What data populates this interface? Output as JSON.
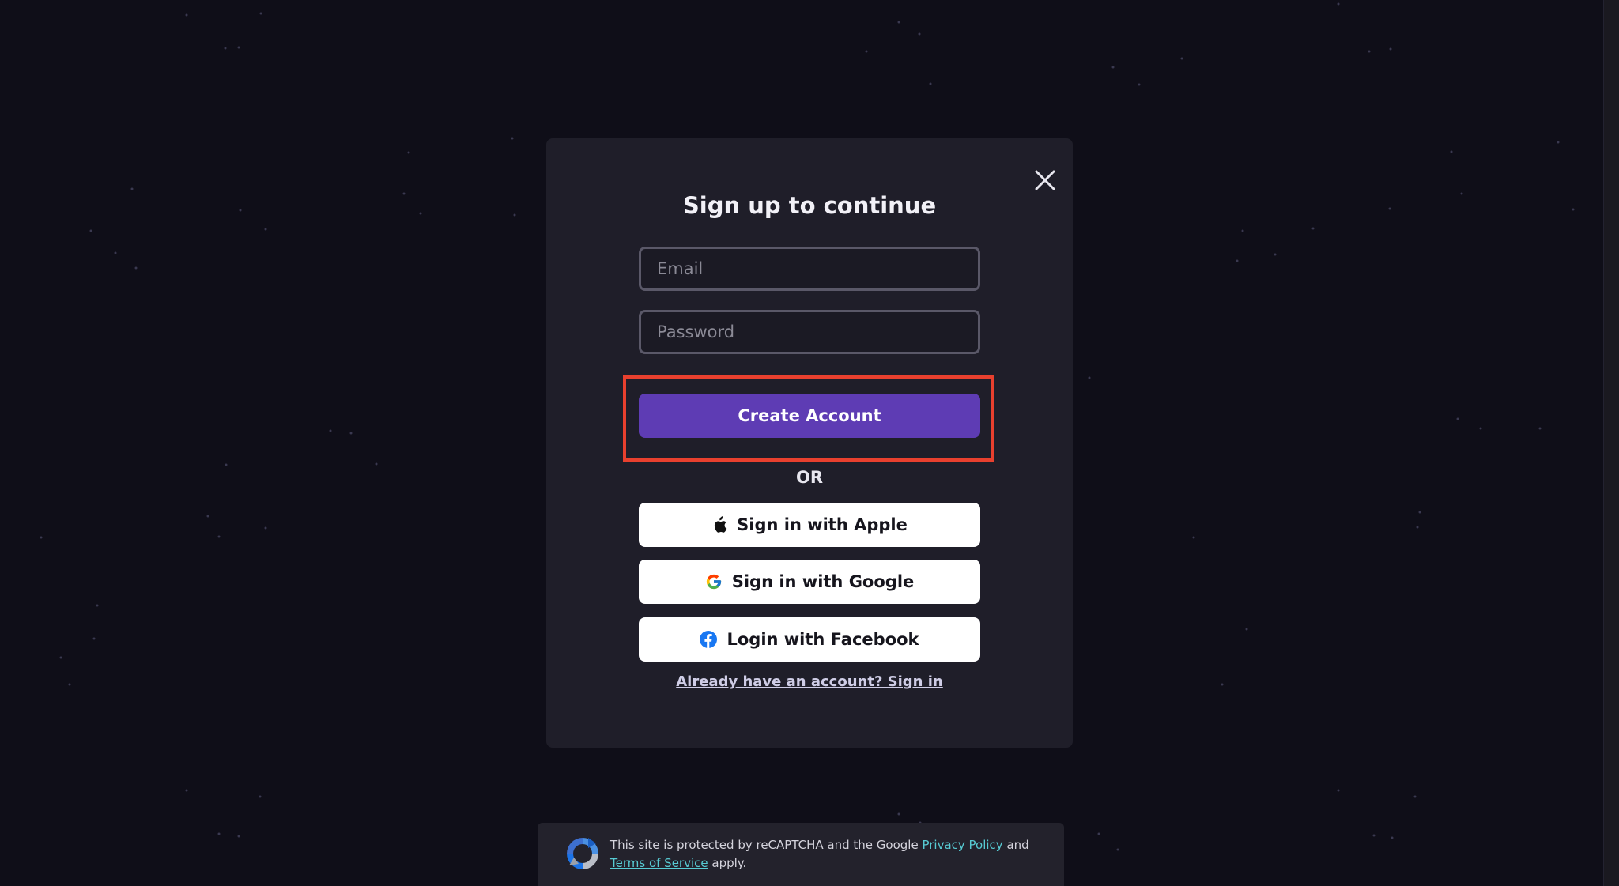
{
  "modal": {
    "title": "Sign up to continue",
    "email_placeholder": "Email",
    "password_placeholder": "Password",
    "create_account_label": "Create Account",
    "or_text": "OR",
    "apple_label": "Sign in with Apple",
    "google_label": "Sign in with Google",
    "facebook_label": "Login with Facebook",
    "signin_link_label": "Already have an account? Sign in",
    "close_icon": "close-icon"
  },
  "recaptcha": {
    "prefix": "This site is protected by reCAPTCHA and the Google",
    "privacy_label": "Privacy Policy",
    "and_text": "and",
    "terms_label": "Terms of Service",
    "suffix": "apply."
  },
  "colors": {
    "background": "#0f0e18",
    "modal": "#1f1e29",
    "primary": "#5e3cb4",
    "highlight": "#e8402e",
    "link": "#57cbd3"
  }
}
